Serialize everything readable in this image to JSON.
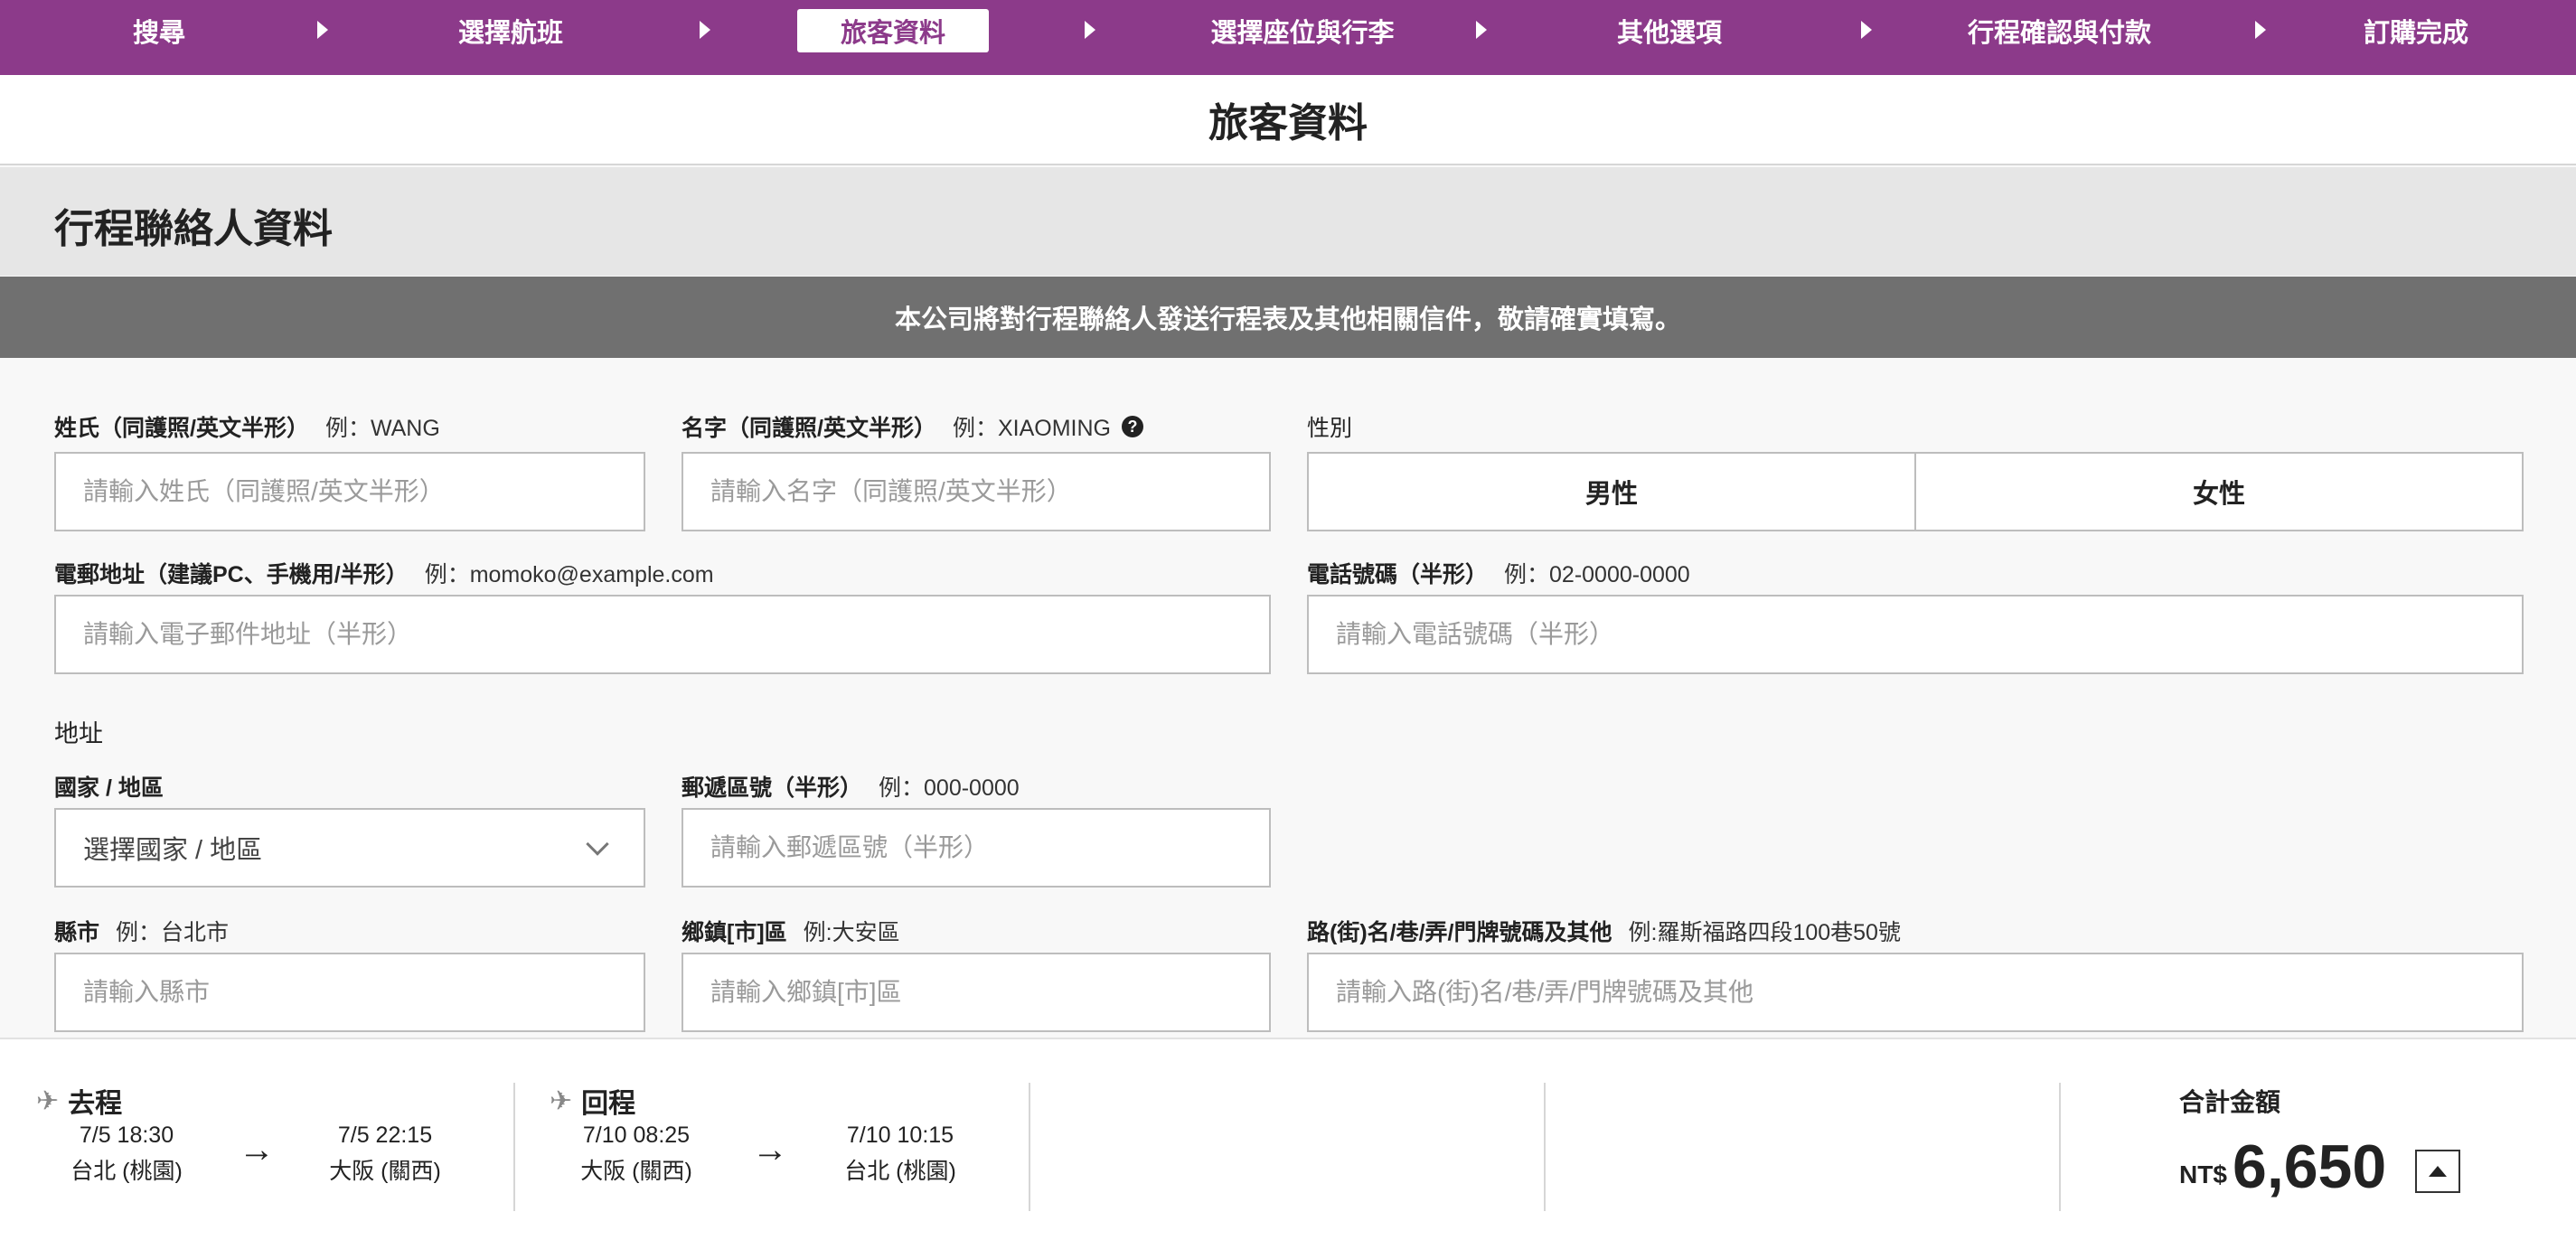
{
  "steps": [
    "搜尋",
    "選擇航班",
    "旅客資料",
    "選擇座位與行李",
    "其他選項",
    "行程確認與付款",
    "訂購完成"
  ],
  "active_step": "旅客資料",
  "page_title": "旅客資料",
  "section_title": "行程聯絡人資料",
  "notice": "本公司將對行程聯絡人發送行程表及其他相關信件，敬請確實填寫。",
  "form": {
    "last_name": {
      "label": "姓氏（同護照/英文半形）",
      "example": "例：WANG",
      "placeholder": "請輸入姓氏（同護照/英文半形）"
    },
    "first_name": {
      "label": "名字（同護照/英文半形）",
      "example": "例：XIAOMING",
      "help_icon": "question-circle-icon",
      "placeholder": "請輸入名字（同護照/英文半形）"
    },
    "gender": {
      "label": "性別",
      "options": [
        "男性",
        "女性"
      ]
    },
    "email": {
      "label": "電郵地址（建議PC、手機用/半形）",
      "example": "例：momoko@example.com",
      "placeholder": "請輸入電子郵件地址（半形）"
    },
    "phone": {
      "label": "電話號碼（半形）",
      "example": "例：02-0000-0000",
      "placeholder": "請輸入電話號碼（半形）"
    },
    "address_label": "地址",
    "country": {
      "label": "國家 / 地區",
      "selected": "選擇國家 / 地區"
    },
    "postal": {
      "label": "郵遞區號（半形）",
      "example": "例：000-0000",
      "placeholder": "請輸入郵遞區號（半形）"
    },
    "city": {
      "label": "縣市",
      "example": "例：台北市",
      "placeholder": "請輸入縣市"
    },
    "district": {
      "label": "鄉鎮[市]區",
      "example": "例:大安區",
      "placeholder": "請輸入鄉鎮[市]區"
    },
    "street": {
      "label": "路(街)名/巷/弄/門牌號碼及其他",
      "example": "例:羅斯福路四段100巷50號",
      "placeholder": "請輸入路(街)名/巷/弄/門牌號碼及其他"
    }
  },
  "summary": {
    "outbound": {
      "title": "去程",
      "dep_time": "7/5 18:30",
      "dep_city": "台北 (桃園)",
      "arr_time": "7/5 22:15",
      "arr_city": "大阪 (關西)",
      "arrow": "→"
    },
    "inbound": {
      "title": "回程",
      "dep_time": "7/10 08:25",
      "dep_city": "大阪 (關西)",
      "arr_time": "7/10 10:15",
      "arr_city": "台北 (桃園)",
      "arrow": "→"
    },
    "plane_icon": "✈",
    "total_label": "合計金額",
    "currency": "NT$",
    "total": "6,650"
  },
  "colors": {
    "brand": "#8c3a8a",
    "notice_bg": "#707070",
    "section_bg": "#e6e6e6"
  }
}
